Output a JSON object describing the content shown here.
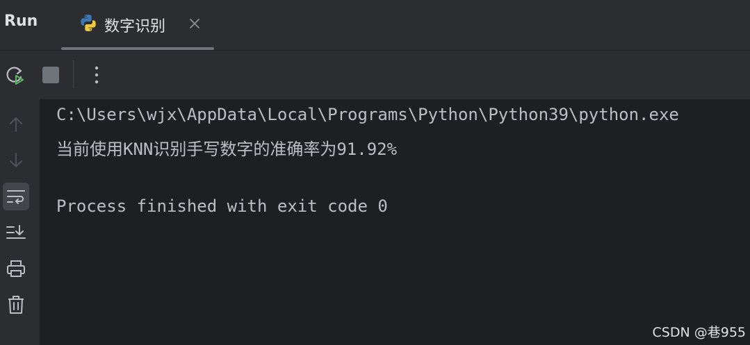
{
  "header": {
    "title": "Run",
    "tab": {
      "label": "数字识别",
      "icon": "python-icon",
      "close_icon": "close-icon"
    }
  },
  "toolbar": {
    "buttons": [
      {
        "name": "rerun-button",
        "icon": "rerun-icon"
      },
      {
        "name": "stop-button",
        "icon": "stop-icon"
      },
      {
        "name": "more-button",
        "icon": "more-vertical-icon"
      }
    ]
  },
  "gutter": {
    "buttons": [
      {
        "name": "scroll-up-button",
        "icon": "arrow-up-icon"
      },
      {
        "name": "scroll-down-button",
        "icon": "arrow-down-icon"
      },
      {
        "name": "soft-wrap-button",
        "icon": "soft-wrap-icon",
        "active": true
      },
      {
        "name": "scroll-to-end-button",
        "icon": "scroll-to-end-icon"
      },
      {
        "name": "print-button",
        "icon": "print-icon"
      },
      {
        "name": "clear-button",
        "icon": "trash-icon"
      }
    ]
  },
  "console": {
    "lines": [
      "C:\\Users\\wjx\\AppData\\Local\\Programs\\Python\\Python39\\python.exe",
      "当前使用KNN识别手写数字的准确率为91.92%",
      "",
      "Process finished with exit code 0"
    ]
  },
  "watermark": "CSDN @巷955",
  "colors": {
    "background": "#1e1f22",
    "panel": "#2b2d30",
    "text": "#bcbec4",
    "rerun_green": "#5fb865",
    "python_blue": "#3b78b3",
    "python_yellow": "#f0c93f"
  }
}
